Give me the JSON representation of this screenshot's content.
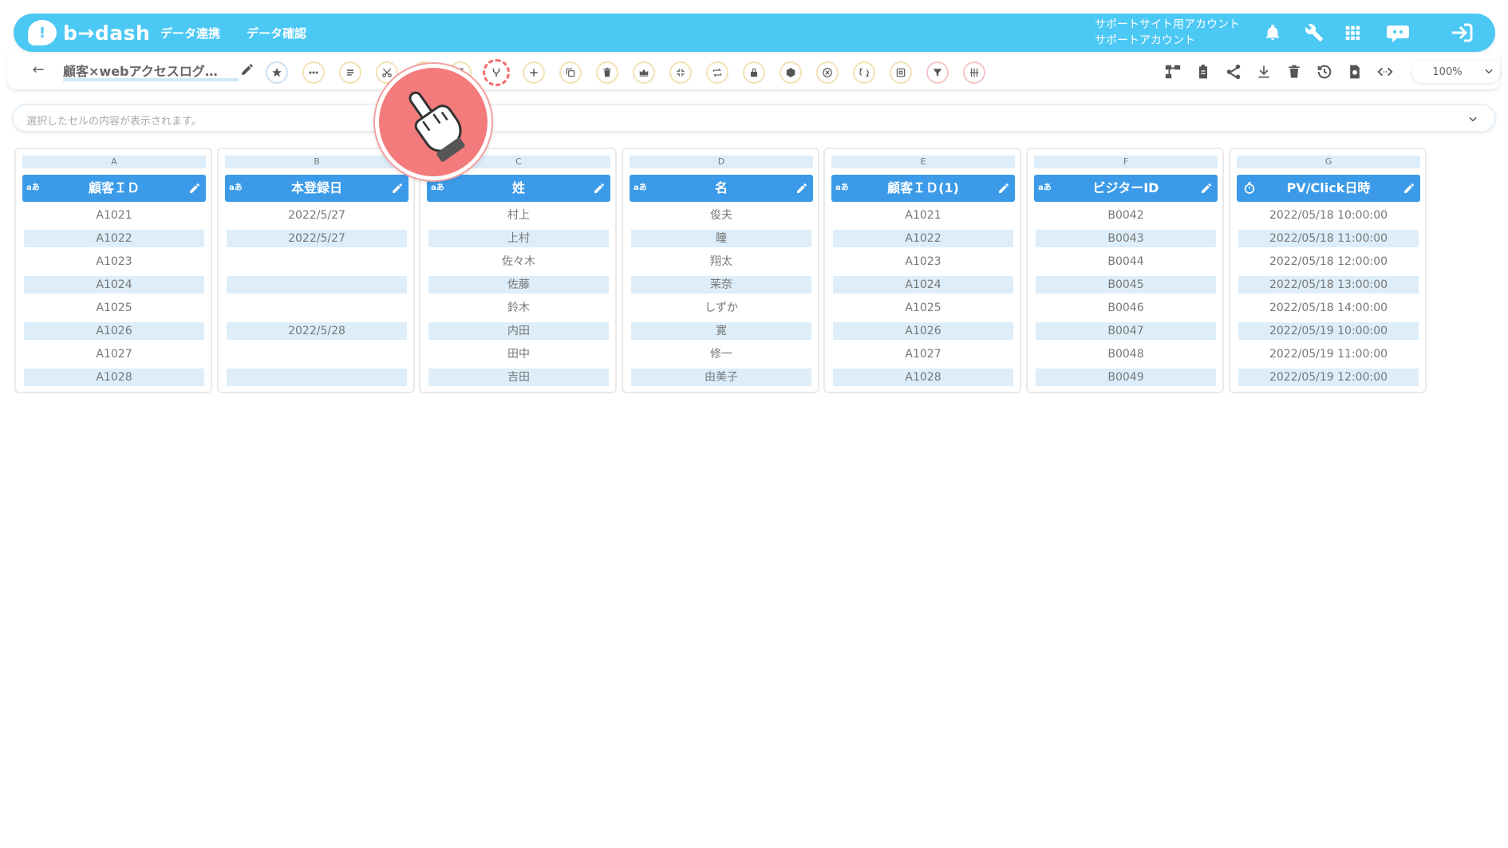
{
  "header": {
    "logo_text": "b→dash",
    "nav": [
      "データ連携",
      "データ確認"
    ],
    "account_line1": "サポートサイト用アカウント",
    "account_line2": "サポートアカウント"
  },
  "toolbar": {
    "title": "顧客×webアクセスログ…",
    "zoom": "100%"
  },
  "cellbar": {
    "placeholder": "選択したセルの内容が表示されます。"
  },
  "columns": [
    {
      "letter": "A",
      "type": "aあ",
      "name": "顧客ＩＤ",
      "cells": [
        "A1021",
        "A1022",
        "A1023",
        "A1024",
        "A1025",
        "A1026",
        "A1027",
        "A1028"
      ]
    },
    {
      "letter": "B",
      "type": "aあ",
      "name": "本登録日",
      "cells": [
        "2022/5/27",
        "2022/5/27",
        "",
        "",
        "",
        "2022/5/28",
        "",
        ""
      ]
    },
    {
      "letter": "C",
      "type": "aあ",
      "name": "姓",
      "cells": [
        "村上",
        "上村",
        "佐々木",
        "佐藤",
        "鈴木",
        "内田",
        "田中",
        "吉田"
      ]
    },
    {
      "letter": "D",
      "type": "aあ",
      "name": "名",
      "cells": [
        "俊夫",
        "瞳",
        "翔太",
        "茉奈",
        "しずか",
        "寛",
        "修一",
        "由美子"
      ]
    },
    {
      "letter": "E",
      "type": "aあ",
      "name": "顧客ＩＤ(1)",
      "cells": [
        "A1021",
        "A1022",
        "A1023",
        "A1024",
        "A1025",
        "A1026",
        "A1027",
        "A1028"
      ]
    },
    {
      "letter": "F",
      "type": "aあ",
      "name": "ビジターID",
      "cells": [
        "B0042",
        "B0043",
        "B0044",
        "B0045",
        "B0046",
        "B0047",
        "B0048",
        "B0049"
      ]
    },
    {
      "letter": "G",
      "type": "timer",
      "name": "PV/Click日時",
      "cells": [
        "2022/05/18 10:00:00",
        "2022/05/18 11:00:00",
        "2022/05/18 12:00:00",
        "2022/05/18 13:00:00",
        "2022/05/18 14:00:00",
        "2022/05/19 10:00:00",
        "2022/05/19 11:00:00",
        "2022/05/19 12:00:00"
      ]
    }
  ],
  "colors": {
    "header_bg": "#4cc8f4",
    "column_header_bg": "#3b9be8",
    "cell_shade": "#ddeefa",
    "pointer_bg": "#f37b7b"
  }
}
